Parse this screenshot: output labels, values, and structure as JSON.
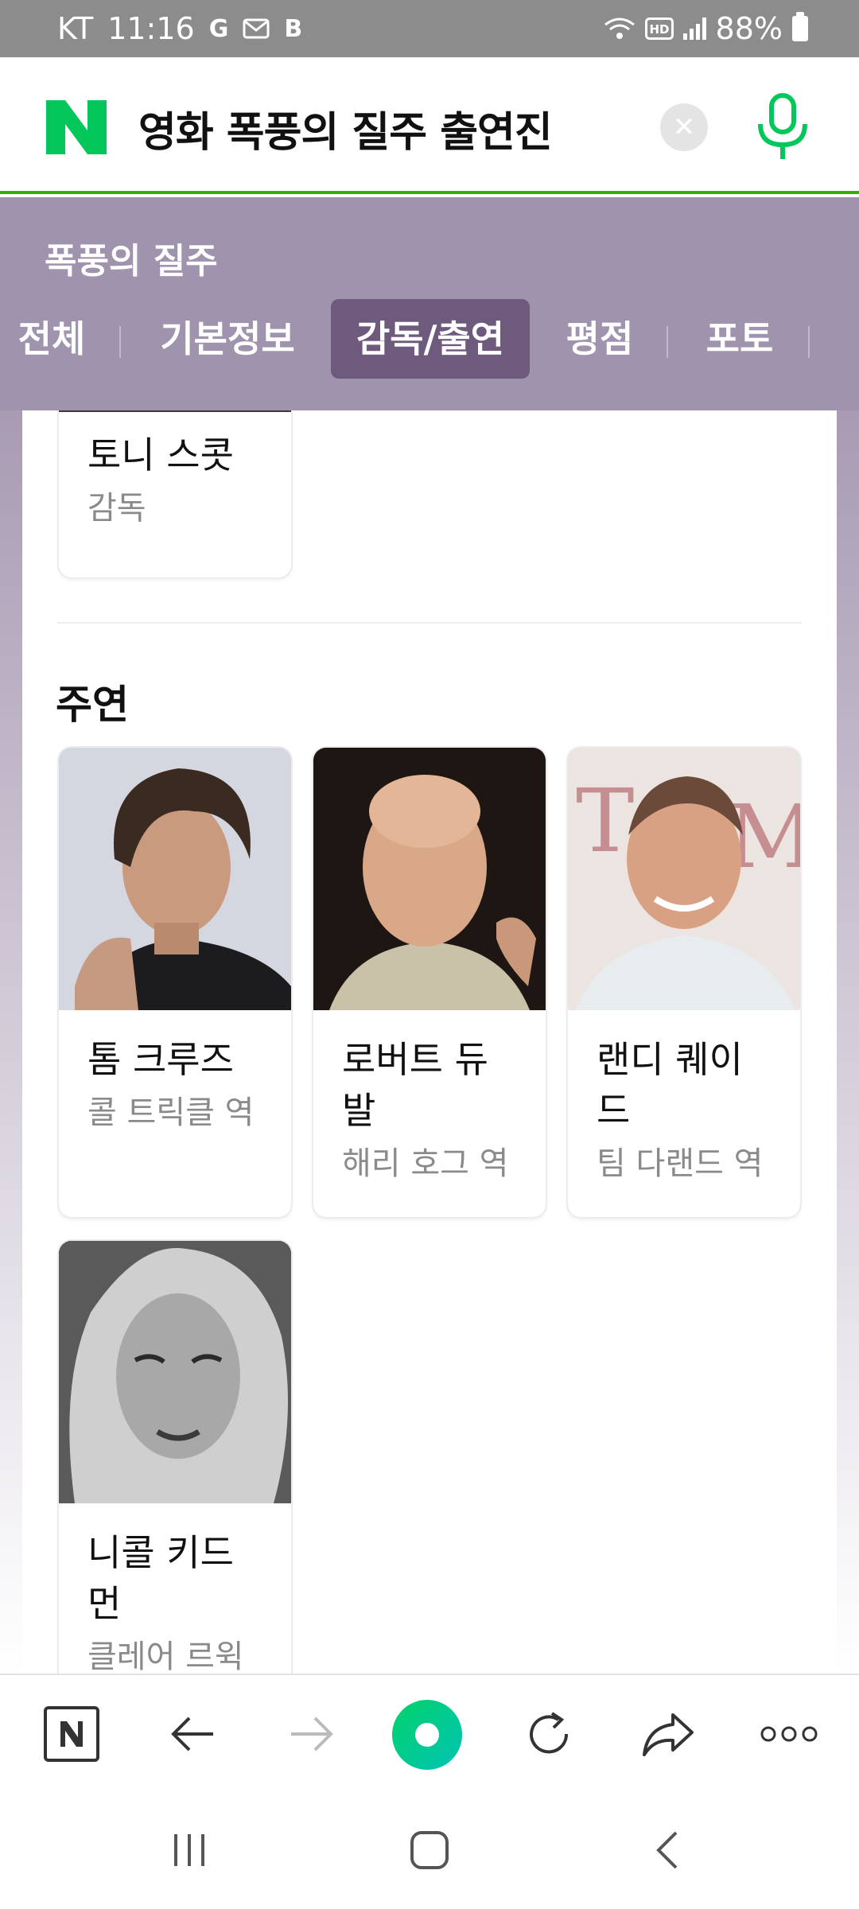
{
  "status_bar": {
    "carrier": "KT",
    "time": "11:16",
    "icons": [
      "google-icon",
      "mail-icon",
      "b-icon"
    ],
    "right_icons": [
      "wifi-icon",
      "hd-icon",
      "signal-icon"
    ],
    "hd": "HD",
    "battery": "88%"
  },
  "search": {
    "query": "영화 폭풍의 질주 출연진",
    "clear_icon": "close-icon",
    "mic_icon": "microphone-icon",
    "logo": "N"
  },
  "topic": {
    "title": "폭풍의 질주",
    "tabs": [
      {
        "label": "전체"
      },
      {
        "label": "기본정보"
      },
      {
        "label": "감독/출연"
      },
      {
        "label": "평점"
      },
      {
        "label": "포토"
      }
    ],
    "active_tab": "감독/출연"
  },
  "director": {
    "name": "토니 스콧",
    "role": "감독"
  },
  "cast": {
    "heading": "주연",
    "people": [
      {
        "name": "톰 크루즈",
        "role": "콜 트릭클 역"
      },
      {
        "name": "로버트 듀발",
        "role": "해리 호그 역"
      },
      {
        "name": "랜디 퀘이드",
        "role": "팀 다랜드 역"
      },
      {
        "name": "니콜 키드먼",
        "role": "클레어 르윅"
      }
    ]
  },
  "toolbar": {
    "icons": [
      "naver-home-icon",
      "back-arrow-icon",
      "forward-arrow-icon",
      "green-dot-icon",
      "refresh-icon",
      "share-icon",
      "more-icon"
    ]
  },
  "nav": {
    "icons": [
      "recent-apps-icon",
      "home-icon",
      "back-icon"
    ]
  },
  "colors": {
    "naver_green": "#03c75a",
    "topic_purple": "#a093ad",
    "active_tab": "#6d5a7d"
  }
}
